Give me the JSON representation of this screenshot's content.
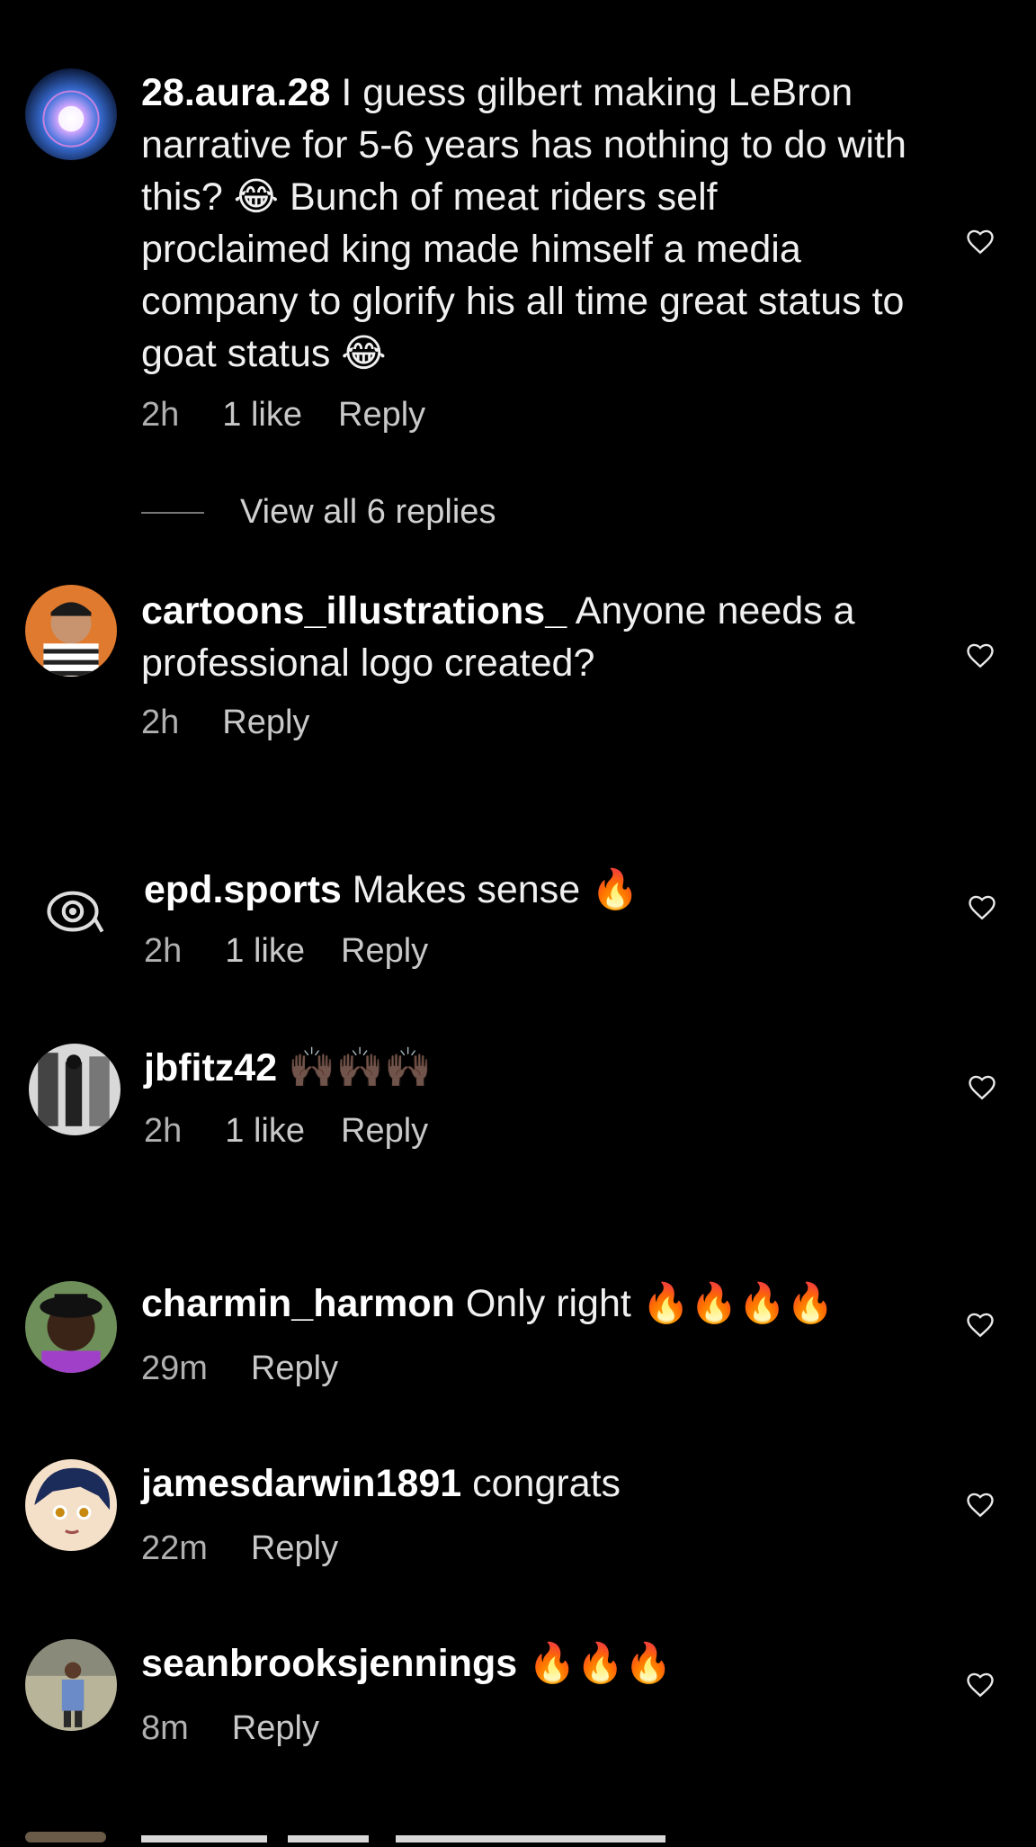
{
  "comments": [
    {
      "username": "28.aura.28",
      "text": "I guess gilbert making LeBron narrative for 5-6 years has nothing to do with this? 😂 Bunch of meat riders self proclaimed king made himself a media company to glorify his all time great status to goat status 😂",
      "time": "2h",
      "likes": "1 like",
      "reply": "Reply",
      "view_replies": "View all 6 replies"
    },
    {
      "username": "cartoons_illustrations_",
      "text": "Anyone needs a professional logo created?",
      "time": "2h",
      "likes": "",
      "reply": "Reply"
    },
    {
      "username": "epd.sports",
      "text": "Makes sense 🔥",
      "time": "2h",
      "likes": "1 like",
      "reply": "Reply"
    },
    {
      "username": "jbfitz42",
      "text": "🙌🏿🙌🏿🙌🏿",
      "time": "2h",
      "likes": "1 like",
      "reply": "Reply"
    },
    {
      "username": "charmin_harmon",
      "text": "Only right 🔥🔥🔥🔥",
      "time": "29m",
      "likes": "",
      "reply": "Reply"
    },
    {
      "username": "jamesdarwin1891",
      "text": "congrats",
      "time": "22m",
      "likes": "",
      "reply": "Reply"
    },
    {
      "username": "seanbrooksjennings",
      "text": "🔥🔥🔥",
      "time": "8m",
      "likes": "",
      "reply": "Reply"
    }
  ],
  "icons": {
    "like": "heart-outline-icon"
  },
  "colors": {
    "background": "#000000",
    "text": "#f0f0f0",
    "meta": "#b0b0b0"
  }
}
